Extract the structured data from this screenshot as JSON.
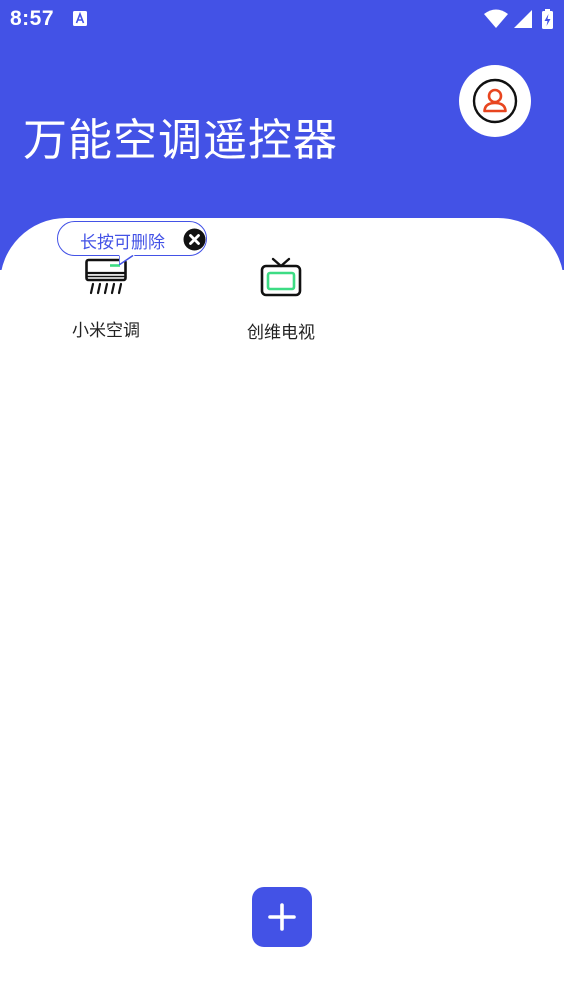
{
  "status_bar": {
    "time": "8:57",
    "icons": [
      "a-notification-icon",
      "wifi-icon",
      "signal-icon",
      "battery-charging-icon"
    ]
  },
  "header": {
    "title": "万能空调遥控器",
    "background_color": "#4352e6",
    "profile_icon": "user-profile-icon"
  },
  "devices": [
    {
      "label": "小米空调",
      "icon": "air-conditioner-icon"
    },
    {
      "label": "创维电视",
      "icon": "tv-icon"
    }
  ],
  "tooltip": {
    "text": "长按可删除",
    "close_icon": "close-circle-icon"
  },
  "fab": {
    "icon": "plus-icon",
    "color": "#4352e6"
  }
}
